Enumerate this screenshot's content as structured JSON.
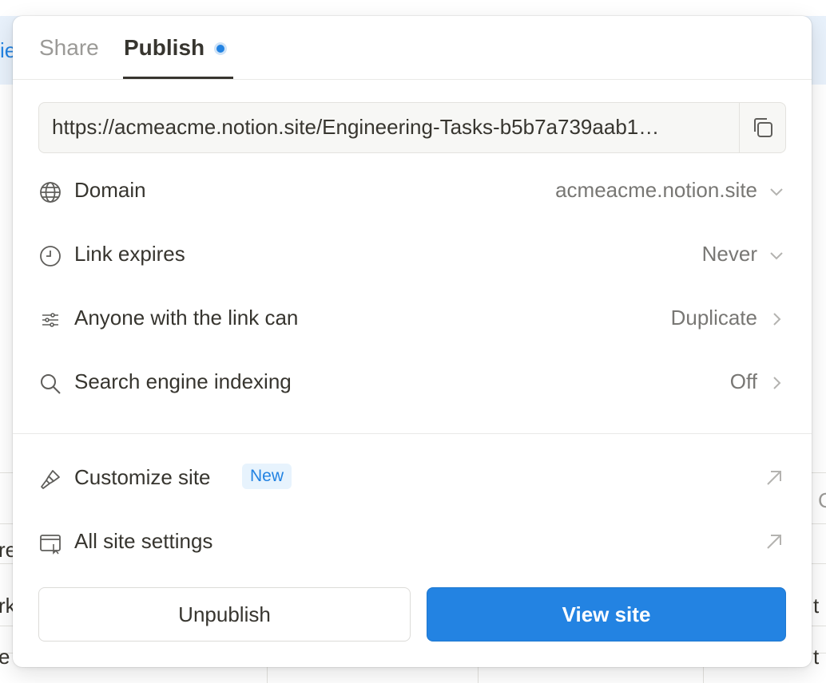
{
  "background": {
    "header_fragment": "ie",
    "row_fragments": [
      "re",
      "rk",
      "e",
      "t",
      "t",
      "C"
    ]
  },
  "popover": {
    "tabs": [
      {
        "label": "Share",
        "active": false
      },
      {
        "label": "Publish",
        "active": true
      }
    ],
    "url": "https://acmeacme.notion.site/Engineering-Tasks-b5b7a739aab1…",
    "settings": [
      {
        "icon": "globe-icon",
        "label": "Domain",
        "value": "acmeacme.notion.site",
        "control": "chevron-down-icon"
      },
      {
        "icon": "clock-icon",
        "label": "Link expires",
        "value": "Never",
        "control": "chevron-down-icon"
      },
      {
        "icon": "sliders-icon",
        "label": "Anyone with the link can",
        "value": "Duplicate",
        "control": "chevron-right-icon"
      },
      {
        "icon": "search-icon",
        "label": "Search engine indexing",
        "value": "Off",
        "control": "chevron-right-icon"
      }
    ],
    "links": [
      {
        "icon": "paintbrush-icon",
        "label": "Customize site",
        "badge": "New"
      },
      {
        "icon": "browser-window-icon",
        "label": "All site settings",
        "badge": ""
      }
    ],
    "buttons": {
      "unpublish": "Unpublish",
      "view_site": "View site"
    }
  },
  "colors": {
    "accent": "#2383e2",
    "text": "#37352f",
    "muted": "#787774",
    "tab_inactive": "#9b9a97"
  }
}
